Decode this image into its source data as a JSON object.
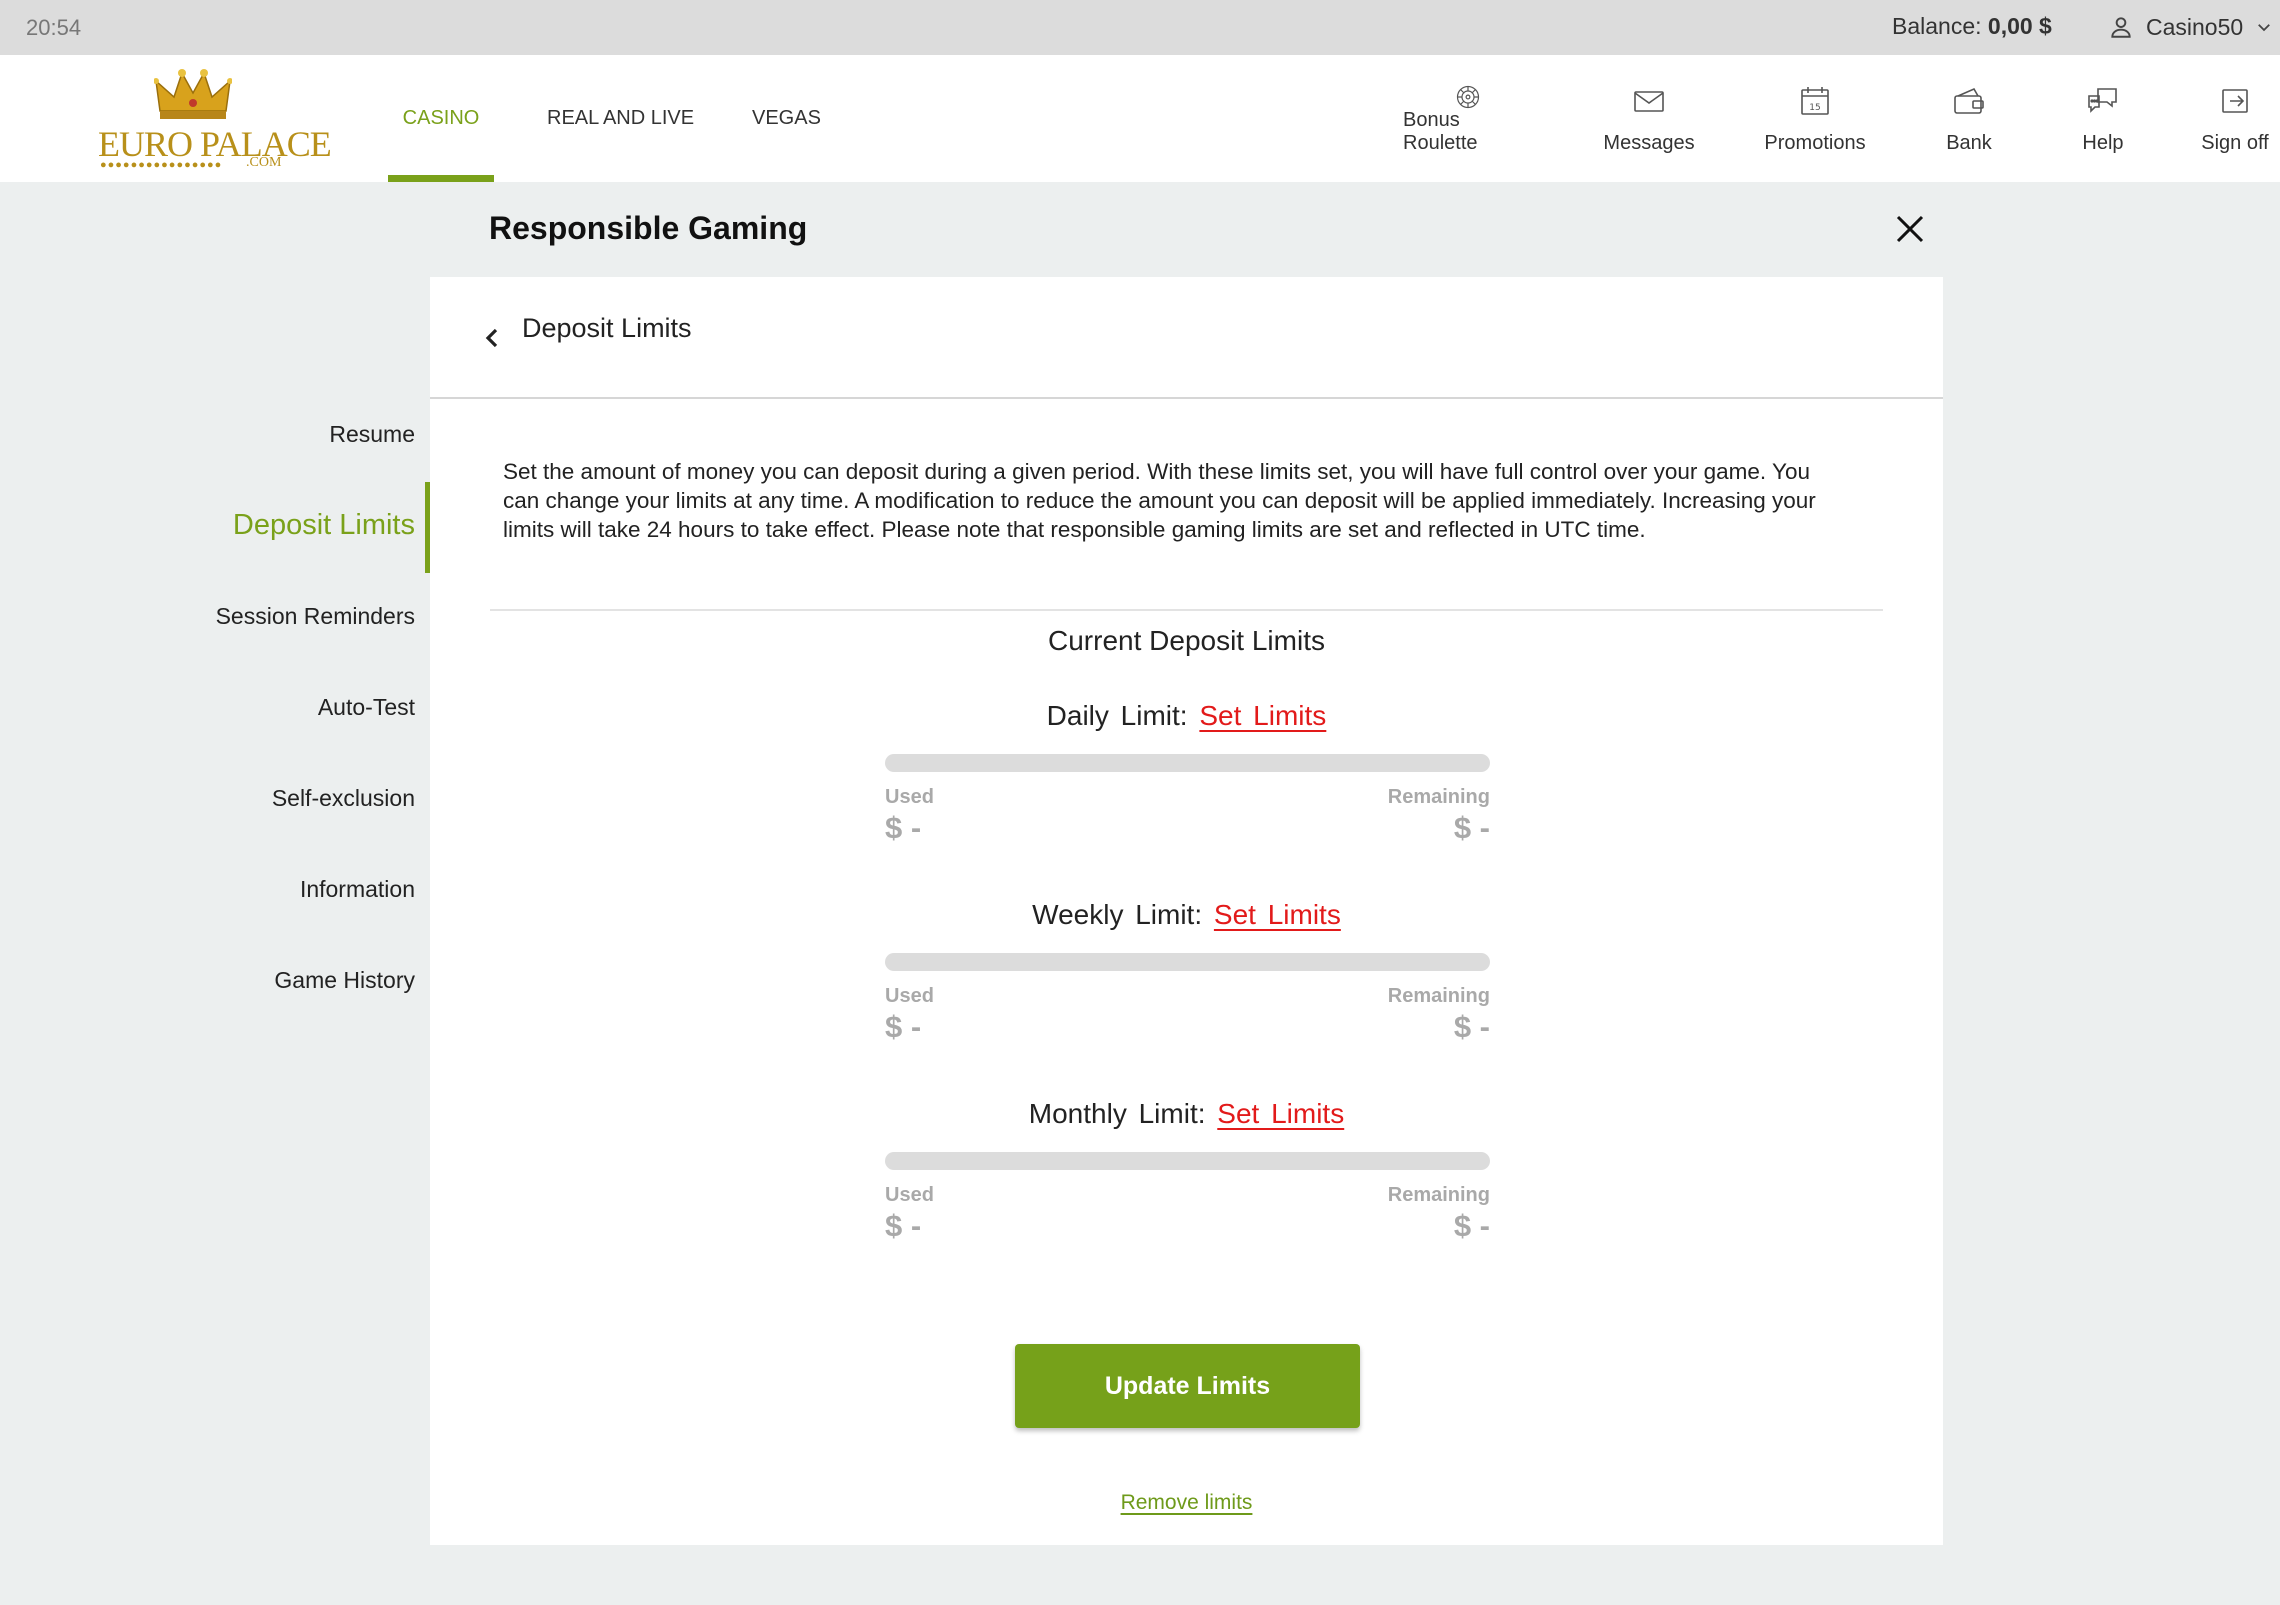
{
  "statusbar": {
    "time": "20:54",
    "balance_label": "Balance:",
    "balance_value": "0,00 $",
    "username": "Casino50",
    "user_icon": "user-icon",
    "dropdown_icon": "chevron-down-icon"
  },
  "header": {
    "logo": {
      "brand": "EURO PALACE",
      "suffix": ".COM"
    },
    "tabs": [
      {
        "label": "CASINO",
        "active": true
      },
      {
        "label": "REAL AND LIVE",
        "active": false
      },
      {
        "label": "VEGAS",
        "active": false
      }
    ],
    "actions": [
      {
        "label": "Bonus Roulette",
        "icon": "roulette-wheel-icon"
      },
      {
        "label": "Messages",
        "icon": "envelope-icon"
      },
      {
        "label": "Promotions",
        "icon": "calendar-icon",
        "icon_text": "15"
      },
      {
        "label": "Bank",
        "icon": "wallet-icon"
      },
      {
        "label": "Help",
        "icon": "chat-bubbles-icon"
      },
      {
        "label": "Sign off",
        "icon": "sign-off-icon"
      }
    ]
  },
  "page": {
    "title": "Responsible Gaming",
    "close_icon": "close-icon"
  },
  "sidemenu": {
    "items": [
      {
        "label": "Resume",
        "active": false
      },
      {
        "label": "Deposit Limits",
        "active": true
      },
      {
        "label": "Session Reminders",
        "active": false
      },
      {
        "label": "Auto-Test",
        "active": false
      },
      {
        "label": "Self-exclusion",
        "active": false
      },
      {
        "label": "Information",
        "active": false
      },
      {
        "label": "Game History",
        "active": false
      }
    ]
  },
  "panel": {
    "title": "Deposit Limits",
    "back_icon": "chevron-left-icon",
    "description": "Set the amount of money you can deposit during a given period. With these limits set, you will have full control over your game. You can change your limits at any time. A modification to reduce the amount you can deposit will be applied immediately. Increasing your limits will take 24 hours to take effect. Please note that responsible gaming limits are set and reflected in UTC time.",
    "current_title": "Current Deposit Limits",
    "limits": [
      {
        "label": "Daily Limit:",
        "link": "Set Limits",
        "used_label": "Used",
        "used_value": "$ -",
        "remaining_label": "Remaining",
        "remaining_value": "$ -",
        "progress": 0
      },
      {
        "label": "Weekly Limit:",
        "link": "Set Limits",
        "used_label": "Used",
        "used_value": "$ -",
        "remaining_label": "Remaining",
        "remaining_value": "$ -",
        "progress": 0
      },
      {
        "label": "Monthly Limit:",
        "link": "Set Limits",
        "used_label": "Used",
        "used_value": "$ -",
        "remaining_label": "Remaining",
        "remaining_value": "$ -",
        "progress": 0
      }
    ],
    "update_button": "Update Limits",
    "remove_link": "Remove limits"
  },
  "colors": {
    "accent": "#7aa11a",
    "link_red": "#e21a1a",
    "muted": "#a9a9a9",
    "logo_gold": "#b8901a"
  }
}
